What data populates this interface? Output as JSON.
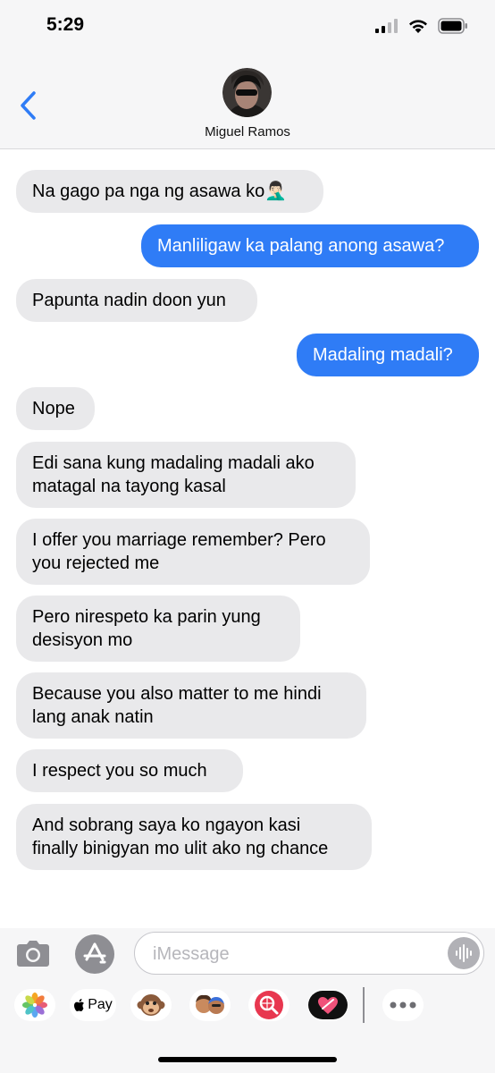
{
  "status_bar": {
    "time": "5:29"
  },
  "header": {
    "contact_name": "Miguel Ramos"
  },
  "messages": [
    {
      "dir": "in",
      "text": "Na gago pa nga ng asawa ko🤦🏻‍♂️"
    },
    {
      "dir": "out",
      "text": "Manliligaw ka palang anong asawa?"
    },
    {
      "dir": "in",
      "text": "Papunta nadin doon yun"
    },
    {
      "dir": "out",
      "text": "Madaling madali?"
    },
    {
      "dir": "in",
      "text": "Nope"
    },
    {
      "dir": "in",
      "lines": [
        "Edi sana kung madaling madali ako",
        "matagal na tayong kasal"
      ]
    },
    {
      "dir": "in",
      "lines": [
        "I offer you marriage remember? Pero",
        "you rejected me"
      ]
    },
    {
      "dir": "in",
      "lines": [
        "Pero nirespeto ka parin yung",
        "desisyon mo"
      ]
    },
    {
      "dir": "in",
      "lines": [
        "Because you also matter to me hindi",
        "lang anak natin"
      ]
    },
    {
      "dir": "in",
      "text": "I respect you so much"
    },
    {
      "dir": "in",
      "lines": [
        "And sobrang saya ko ngayon kasi",
        "finally binigyan mo ulit ako ng chance"
      ]
    }
  ],
  "compose": {
    "placeholder": "iMessage"
  },
  "app_drawer": {
    "apple_pay_label": "Pay",
    "apps": [
      "photos-icon",
      "apple-pay-icon",
      "monkey-memoji-icon",
      "memoji-stickers-icon",
      "web-search-icon",
      "digital-touch-icon",
      "more-icon"
    ]
  },
  "colors": {
    "outgoing_bubble": "#2f7cf6",
    "incoming_bubble": "#e9e9eb",
    "back_chevron": "#2f7cf6"
  }
}
